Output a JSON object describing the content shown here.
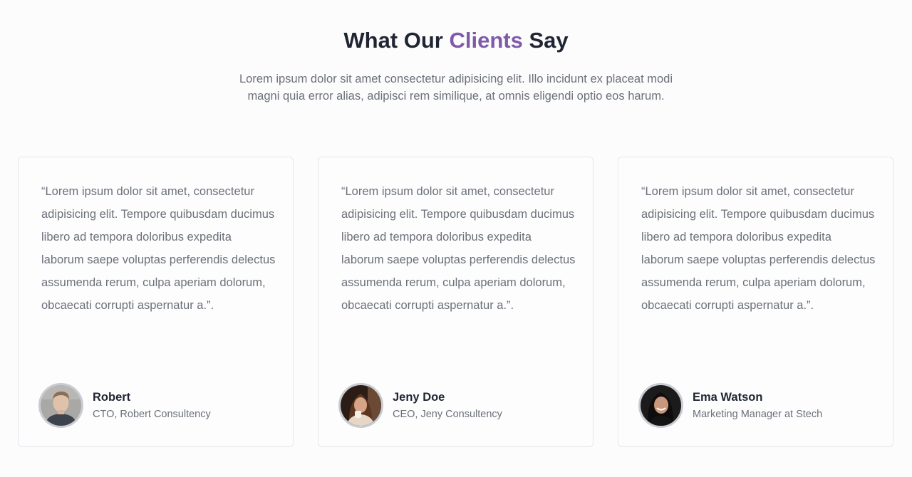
{
  "header": {
    "title_pre": "What Our ",
    "title_accent": "Clients",
    "title_post": " Say",
    "intro": "Lorem ipsum dolor sit amet consectetur adipisicing elit. Illo incidunt ex placeat modi magni quia error alias, adipisci rem similique, at omnis eligendi optio eos harum."
  },
  "colors": {
    "accent": "#7f5aa8",
    "heading": "#1f2532",
    "body_text": "#6b7079",
    "card_border": "#e5e7eb"
  },
  "testimonials": [
    {
      "quote": "“Lorem ipsum dolor sit amet, consectetur adipisicing elit. Tempore quibusdam ducimus libero ad tempora doloribus expedita laborum saepe voluptas perferendis delectus assumenda rerum, culpa aperiam dolorum, obcaecati corrupti aspernatur a.”.",
      "name": "Robert",
      "role": "CTO, Robert Consultency",
      "avatar_icon": "avatar-man-portrait"
    },
    {
      "quote": "“Lorem ipsum dolor sit amet, consectetur adipisicing elit. Tempore quibusdam ducimus libero ad tempora doloribus expedita laborum saepe voluptas perferendis delectus assumenda rerum, culpa aperiam dolorum, obcaecati corrupti aspernatur a.”.",
      "name": "Jeny Doe",
      "role": "CEO, Jeny Consultency",
      "avatar_icon": "avatar-woman-portrait"
    },
    {
      "quote": "“Lorem ipsum dolor sit amet, consectetur adipisicing elit. Tempore quibusdam ducimus libero ad tempora doloribus expedita laborum saepe voluptas perferendis delectus assumenda rerum, culpa aperiam dolorum, obcaecati corrupti aspernatur a.”.",
      "name": "Ema Watson",
      "role": "Marketing Manager at Stech",
      "avatar_icon": "avatar-woman-portrait"
    }
  ]
}
